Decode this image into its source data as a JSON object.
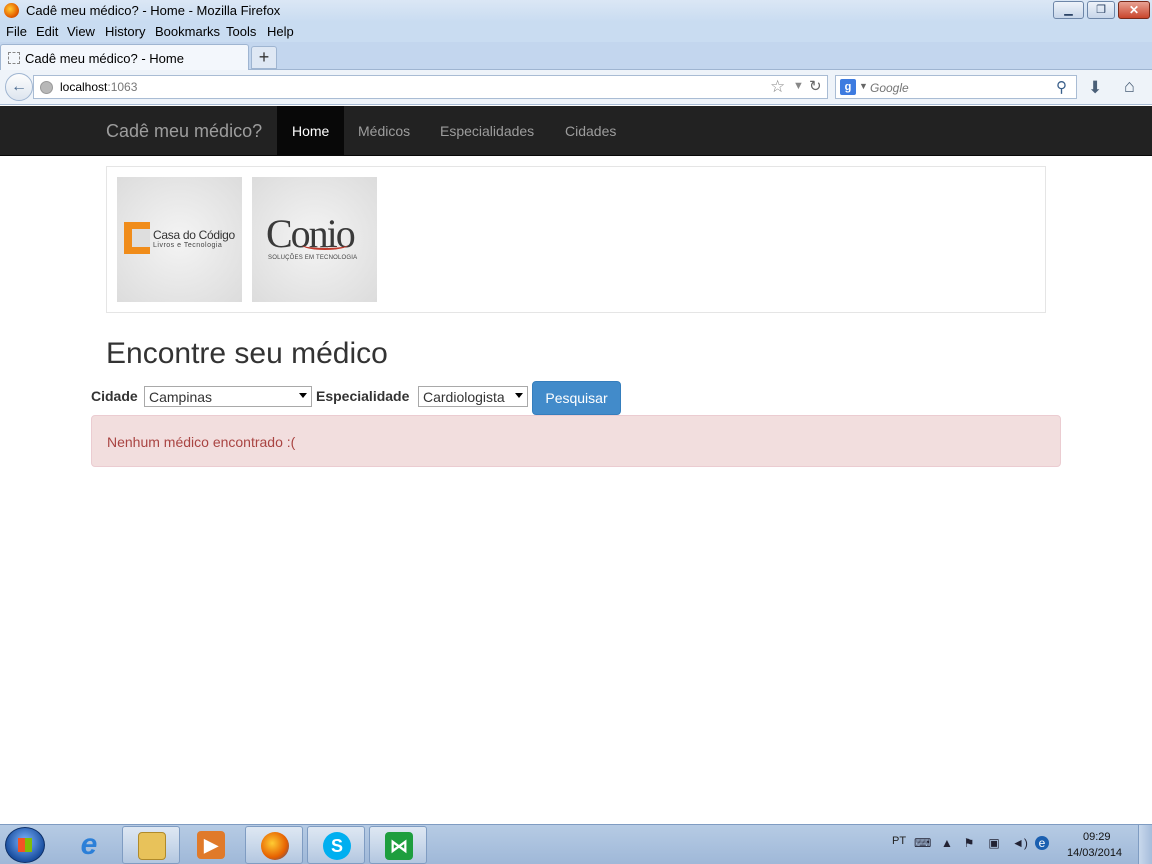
{
  "window": {
    "title": "Cadê meu médico? - Home - Mozilla Firefox"
  },
  "menu": [
    "File",
    "Edit",
    "View",
    "History",
    "Bookmarks",
    "Tools",
    "Help"
  ],
  "browser": {
    "tab_title": "Cadê meu médico? - Home",
    "new_tab": "+",
    "url_host": "localhost",
    "url_port": ":1063",
    "search_placeholder": "Google",
    "search_engine": "g"
  },
  "site": {
    "brand": "Cadê meu médico?",
    "nav": [
      "Home",
      "Médicos",
      "Especialidades",
      "Cidades"
    ],
    "active_nav": "Home",
    "sponsors": {
      "casa_do_codigo_name": "Casa do Código",
      "casa_do_codigo_tagline": "Livros e Tecnologia",
      "conio_name": "Conio",
      "conio_tagline": "SOLUÇÕES EM TECNOLOGIA"
    },
    "heading": "Encontre seu médico",
    "form": {
      "city_label": "Cidade",
      "city_value": "Campinas",
      "specialty_label": "Especialidade",
      "specialty_value": "Cardiologista",
      "search_button": "Pesquisar"
    },
    "alert": "Nenhum médico encontrado :(",
    "colors": {
      "navbar": "#222222",
      "primary": "#428bca",
      "alert_bg": "#f2dede",
      "alert_text": "#a94442"
    }
  },
  "taskbar": {
    "apps": [
      "internet-explorer",
      "file-explorer",
      "media-player",
      "firefox",
      "skype",
      "visual-studio"
    ],
    "language": "PT",
    "time": "09:29",
    "date": "14/03/2014"
  }
}
